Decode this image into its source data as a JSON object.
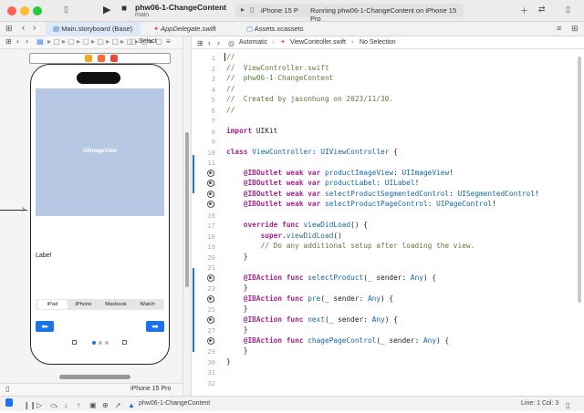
{
  "window": {
    "project_name": "phw06-1-ChangeContent",
    "branch": "main",
    "run_destination": "iPhone 15 P",
    "run_status": "Running phw06-1-ChangeContent on iPhone 15 Pro"
  },
  "tabs": [
    {
      "label": "Main.storyboard (Base)"
    },
    {
      "label": "AppDelegate.swift"
    },
    {
      "label": "Assets.xcassets"
    }
  ],
  "storyboard": {
    "toolbar_label": "Select",
    "image_view_label": "UIImageView",
    "label_text": "Label",
    "segments": [
      "iPad",
      "iPhone",
      "Macbook",
      "Watch"
    ],
    "device_name": "iPhone 15 Pro"
  },
  "jumpbar": {
    "mode": "Automatic",
    "file": "ViewController.swift",
    "selection": "No Selection"
  },
  "editor": {
    "line_numbers": [
      "1",
      "2",
      "3",
      "4",
      "5",
      "6",
      "7",
      "8",
      "9",
      "10",
      "11",
      "12",
      "13",
      "14",
      "15",
      "16",
      "17",
      "18",
      "19",
      "20",
      "21",
      "22",
      "23",
      "24",
      "25",
      "26",
      "27",
      "28",
      "29",
      "30",
      "31",
      "32"
    ]
  },
  "status": {
    "scheme": "phw06-1-ChangeContent",
    "cursor": "Line: 1  Col: 3"
  },
  "colors": {
    "accent": "#1a73e8",
    "keyword": "#a3248f",
    "type": "#0f68a0",
    "comment": "#5d7a3a",
    "image_view_fill": "#b6c8e4"
  }
}
